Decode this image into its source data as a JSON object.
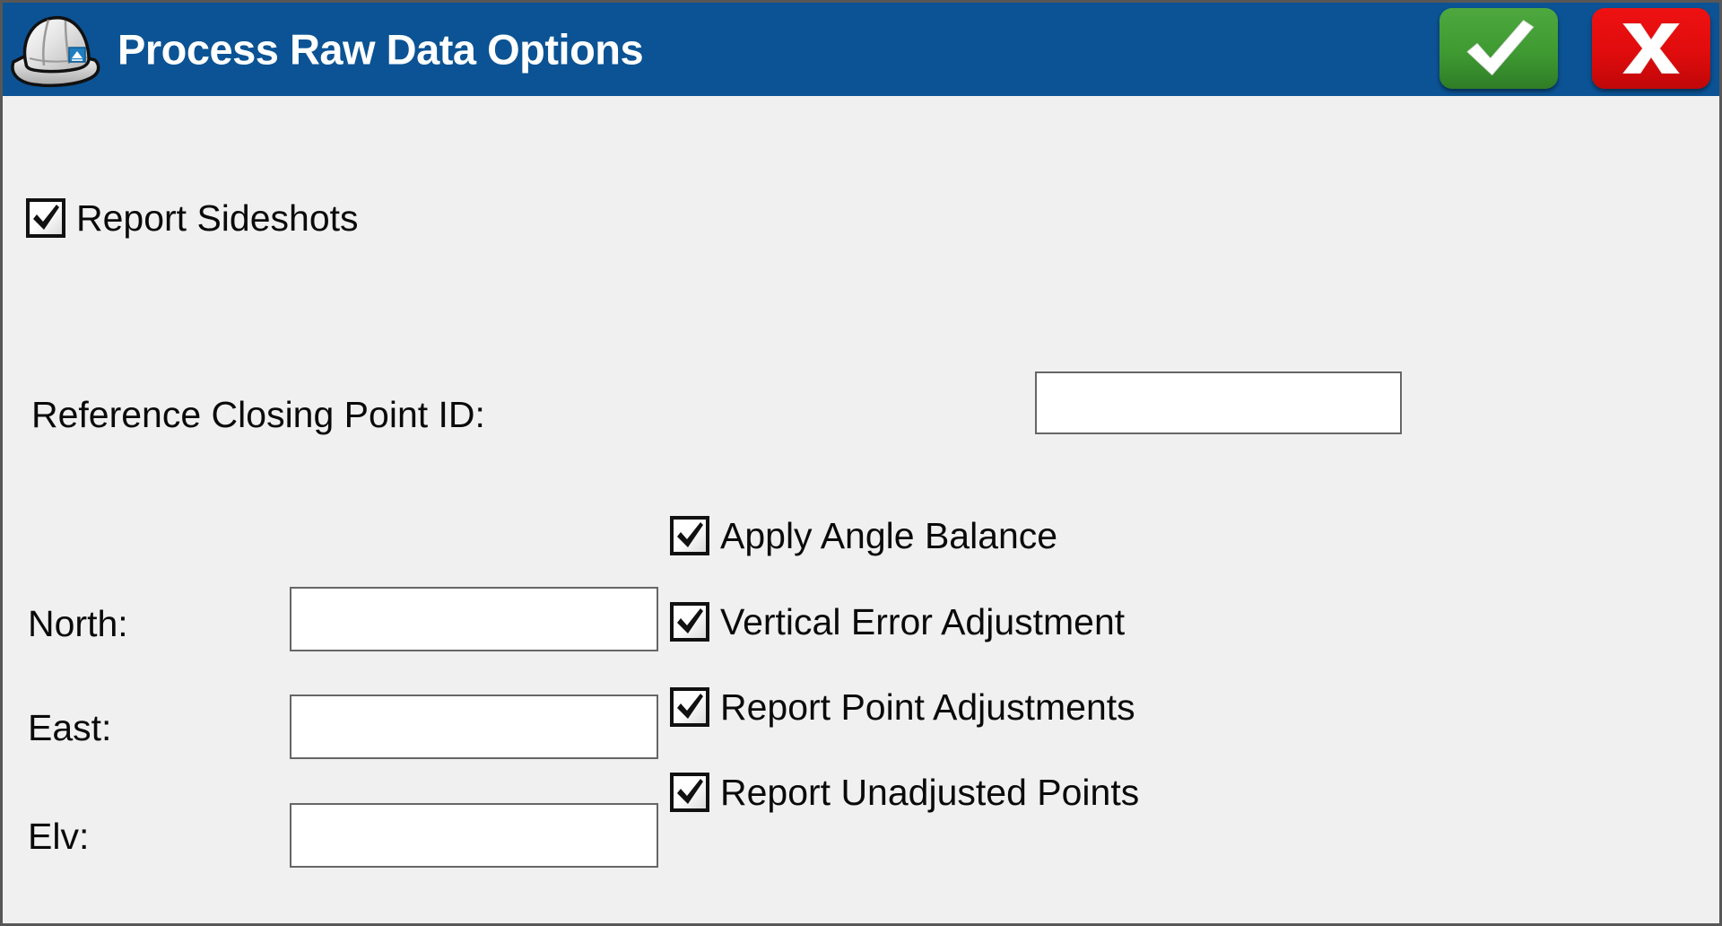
{
  "window": {
    "title": "Process Raw Data Options",
    "accent_color": "#0b5394",
    "body_color": "#f0f0f0",
    "border_color": "#575757"
  },
  "titlebar": {
    "app_icon": "hard-hat-icon",
    "buttons": [
      {
        "name": "accept-button",
        "icon": "check-icon",
        "label": "",
        "color": "#3f9a32"
      },
      {
        "name": "cancel-button",
        "icon": "x-icon",
        "label": "X",
        "color": "#e00c0d"
      }
    ]
  },
  "form": {
    "report_sideshots": {
      "label": "Report Sideshots",
      "checked": true,
      "icon": "checkmark-icon"
    },
    "reference_closing_point": {
      "label": "Reference Closing Point ID:",
      "value": "",
      "placeholder": ""
    },
    "coordinates": [
      {
        "label": "North:",
        "value": "",
        "placeholder": ""
      },
      {
        "label": "East:",
        "value": "",
        "placeholder": ""
      },
      {
        "label": "Elv:",
        "value": "",
        "placeholder": ""
      }
    ],
    "options": [
      {
        "label": "Apply Angle Balance",
        "checked": true,
        "icon": "checkmark-icon"
      },
      {
        "label": "Vertical Error Adjustment",
        "checked": true,
        "icon": "checkmark-icon"
      },
      {
        "label": "Report Point Adjustments",
        "checked": true,
        "icon": "checkmark-icon"
      },
      {
        "label": "Report Unadjusted Points",
        "checked": true,
        "icon": "checkmark-icon"
      }
    ]
  }
}
